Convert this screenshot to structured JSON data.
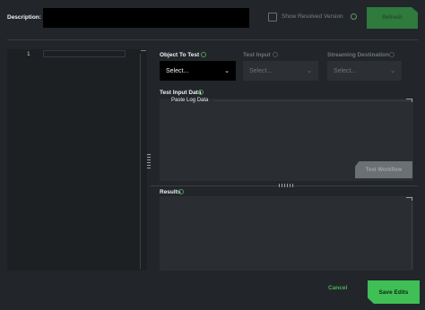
{
  "header": {
    "description_label": "Description:",
    "description_value": "",
    "show_resolved_label": "Show Resolved Version",
    "refresh_label": "Refresh"
  },
  "editor": {
    "line_numbers": [
      "1"
    ]
  },
  "config": {
    "object_to_test_label": "Object To Test",
    "object_to_test_value": "Select...",
    "test_input_label": "Test Input",
    "test_input_value": "Select...",
    "streaming_destination_label": "Streaming Destination",
    "streaming_destination_value": "Select..."
  },
  "test_input_data": {
    "label": "Test Input Data",
    "paste_label": "Paste Log Data",
    "test_workflow_label": "Test Workflow"
  },
  "results": {
    "label": "Results"
  },
  "footer": {
    "cancel_label": "Cancel",
    "save_label": "Save Edits"
  },
  "colors": {
    "background": "#22262a",
    "accent_green": "#3fbf55",
    "refresh_green": "#2f7a3d"
  },
  "icons": {
    "info": "info-circle-icon",
    "chevron": "chevron-down-icon"
  }
}
